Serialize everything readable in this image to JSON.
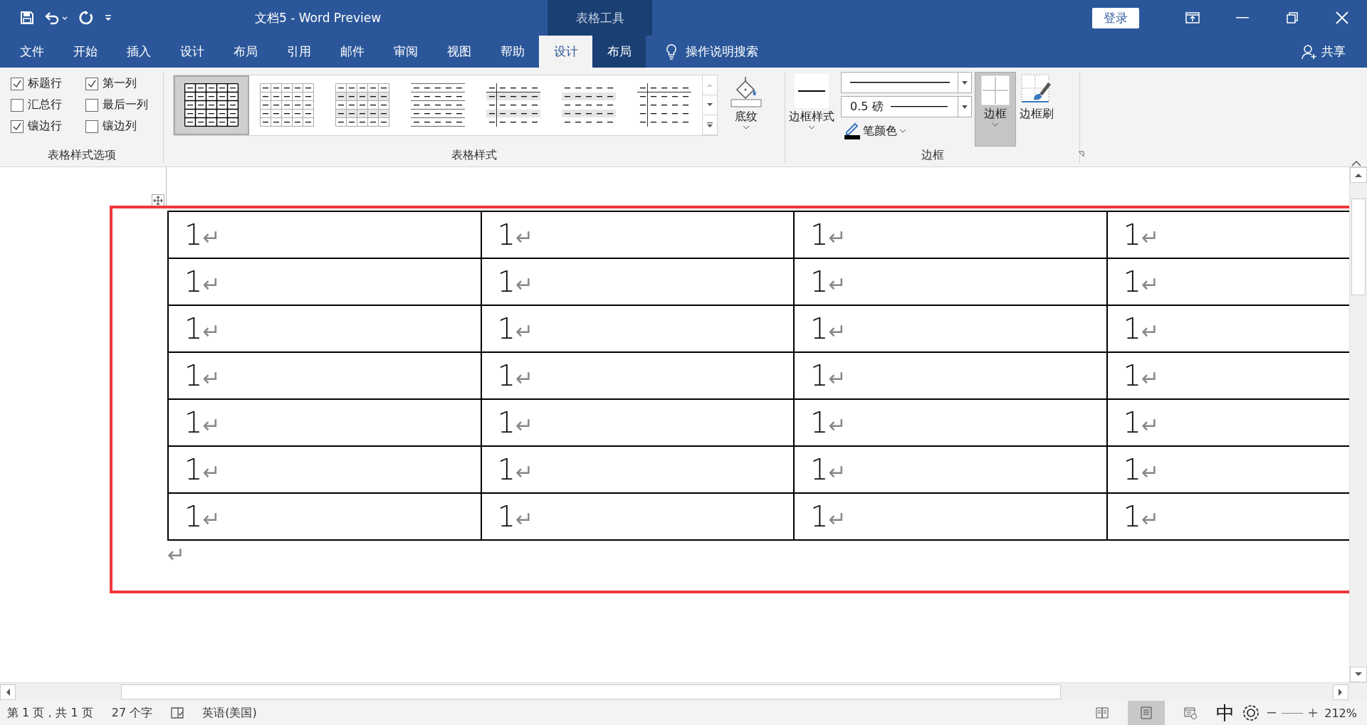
{
  "window": {
    "title": "文档5  -  Word Preview",
    "context_label": "表格工具",
    "sign_in": "登录"
  },
  "tabs": [
    {
      "label": "文件",
      "selected": false,
      "contextual": false
    },
    {
      "label": "开始",
      "selected": false,
      "contextual": false
    },
    {
      "label": "插入",
      "selected": false,
      "contextual": false
    },
    {
      "label": "设计",
      "selected": false,
      "contextual": false
    },
    {
      "label": "布局",
      "selected": false,
      "contextual": false
    },
    {
      "label": "引用",
      "selected": false,
      "contextual": false
    },
    {
      "label": "邮件",
      "selected": false,
      "contextual": false
    },
    {
      "label": "审阅",
      "selected": false,
      "contextual": false
    },
    {
      "label": "视图",
      "selected": false,
      "contextual": false
    },
    {
      "label": "帮助",
      "selected": false,
      "contextual": false
    },
    {
      "label": "设计",
      "selected": true,
      "contextual": true
    },
    {
      "label": "布局",
      "selected": false,
      "contextual": true
    }
  ],
  "tell_me": "操作说明搜索",
  "share": "共享",
  "ribbon": {
    "style_options": {
      "label": "表格样式选项",
      "checkboxes": [
        {
          "label": "标题行",
          "checked": true
        },
        {
          "label": "第一列",
          "checked": true
        },
        {
          "label": "汇总行",
          "checked": false
        },
        {
          "label": "最后一列",
          "checked": false
        },
        {
          "label": "镶边行",
          "checked": true
        },
        {
          "label": "镶边列",
          "checked": false
        }
      ]
    },
    "table_styles": {
      "label": "表格样式",
      "styles": [
        {
          "kind": "grid-bold",
          "selected": true
        },
        {
          "kind": "grid-light",
          "selected": false
        },
        {
          "kind": "grid-shaded",
          "selected": false
        },
        {
          "kind": "horizontal",
          "selected": false
        },
        {
          "kind": "shaded-first-col",
          "selected": false
        },
        {
          "kind": "shaded",
          "selected": false
        },
        {
          "kind": "first-col",
          "selected": false
        }
      ]
    },
    "shading": "底纹",
    "borders": {
      "label": "边框",
      "border_styles": "边框样式",
      "weight": "0.5 磅",
      "pen_color": "笔颜色",
      "borders_button": {
        "label": "边框",
        "selected": true
      },
      "painter": "边框刷"
    }
  },
  "document": {
    "rows": [
      [
        {
          "text": "1",
          "mark": "↵"
        },
        {
          "text": "1",
          "mark": "↵"
        },
        {
          "text": "1",
          "mark": "↵"
        },
        {
          "text": "1",
          "mark": "↵"
        }
      ],
      [
        {
          "text": "1",
          "mark": "↵"
        },
        {
          "text": "1",
          "mark": "↵"
        },
        {
          "text": "1",
          "mark": "↵"
        },
        {
          "text": "1",
          "mark": "↵"
        }
      ],
      [
        {
          "text": "1",
          "mark": "↵"
        },
        {
          "text": "1",
          "mark": "↵"
        },
        {
          "text": "1",
          "mark": "↵"
        },
        {
          "text": "1",
          "mark": "↵"
        }
      ],
      [
        {
          "text": "1",
          "mark": "↵"
        },
        {
          "text": "1",
          "mark": "↵"
        },
        {
          "text": "1",
          "mark": "↵"
        },
        {
          "text": "1",
          "mark": "↵"
        }
      ],
      [
        {
          "text": "1",
          "mark": "↵"
        },
        {
          "text": "1",
          "mark": "↵"
        },
        {
          "text": "1",
          "mark": "↵"
        },
        {
          "text": "1",
          "mark": "↵"
        }
      ],
      [
        {
          "text": "1",
          "mark": "↵"
        },
        {
          "text": "1",
          "mark": "↵"
        },
        {
          "text": "1",
          "mark": "↵"
        },
        {
          "text": "1",
          "mark": "↵"
        }
      ],
      [
        {
          "text": "1",
          "mark": "↵"
        },
        {
          "text": "1",
          "mark": "↵"
        },
        {
          "text": "1",
          "mark": "↵"
        },
        {
          "text": "1",
          "mark": "↵"
        }
      ]
    ],
    "end_mark": "↵"
  },
  "status_bar": {
    "page": "第 1 页，共 1 页",
    "words": "27 个字",
    "language": "英语(美国)",
    "view_modes": [
      {
        "selected": false
      },
      {
        "selected": true
      },
      {
        "selected": false
      }
    ],
    "ime": "中",
    "zoom": "212%"
  }
}
